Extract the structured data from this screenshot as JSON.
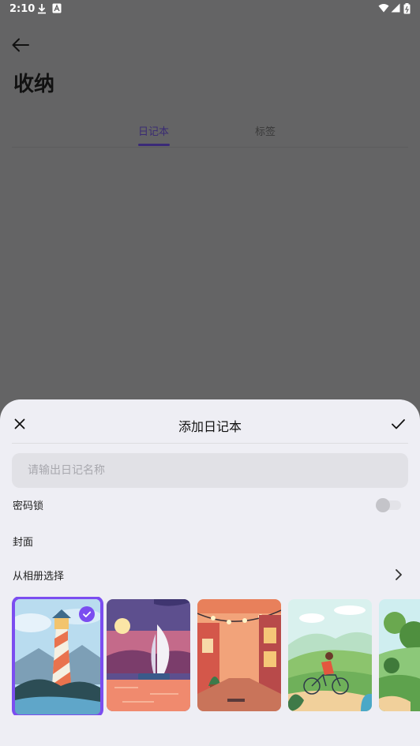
{
  "status_bar": {
    "time": "2:10"
  },
  "page": {
    "title": "收纳",
    "tabs": [
      {
        "label": "日记本",
        "active": true
      },
      {
        "label": "标签",
        "active": false
      }
    ]
  },
  "sheet": {
    "title": "添加日记本",
    "name_input": {
      "placeholder": "请输出日记名称",
      "value": ""
    },
    "password_lock": {
      "label": "密码锁",
      "enabled": false
    },
    "cover": {
      "label": "封面"
    },
    "album": {
      "label": "从相册选择"
    },
    "covers": [
      {
        "name": "lighthouse",
        "selected": true
      },
      {
        "name": "sailboat-sunset",
        "selected": false
      },
      {
        "name": "street-lights",
        "selected": false
      },
      {
        "name": "cyclist-hills",
        "selected": false
      },
      {
        "name": "green-trees",
        "selected": false
      }
    ]
  },
  "colors": {
    "accent": "#7b4df0",
    "scrim": "#646465",
    "sheet_bg": "#eeeef4"
  }
}
